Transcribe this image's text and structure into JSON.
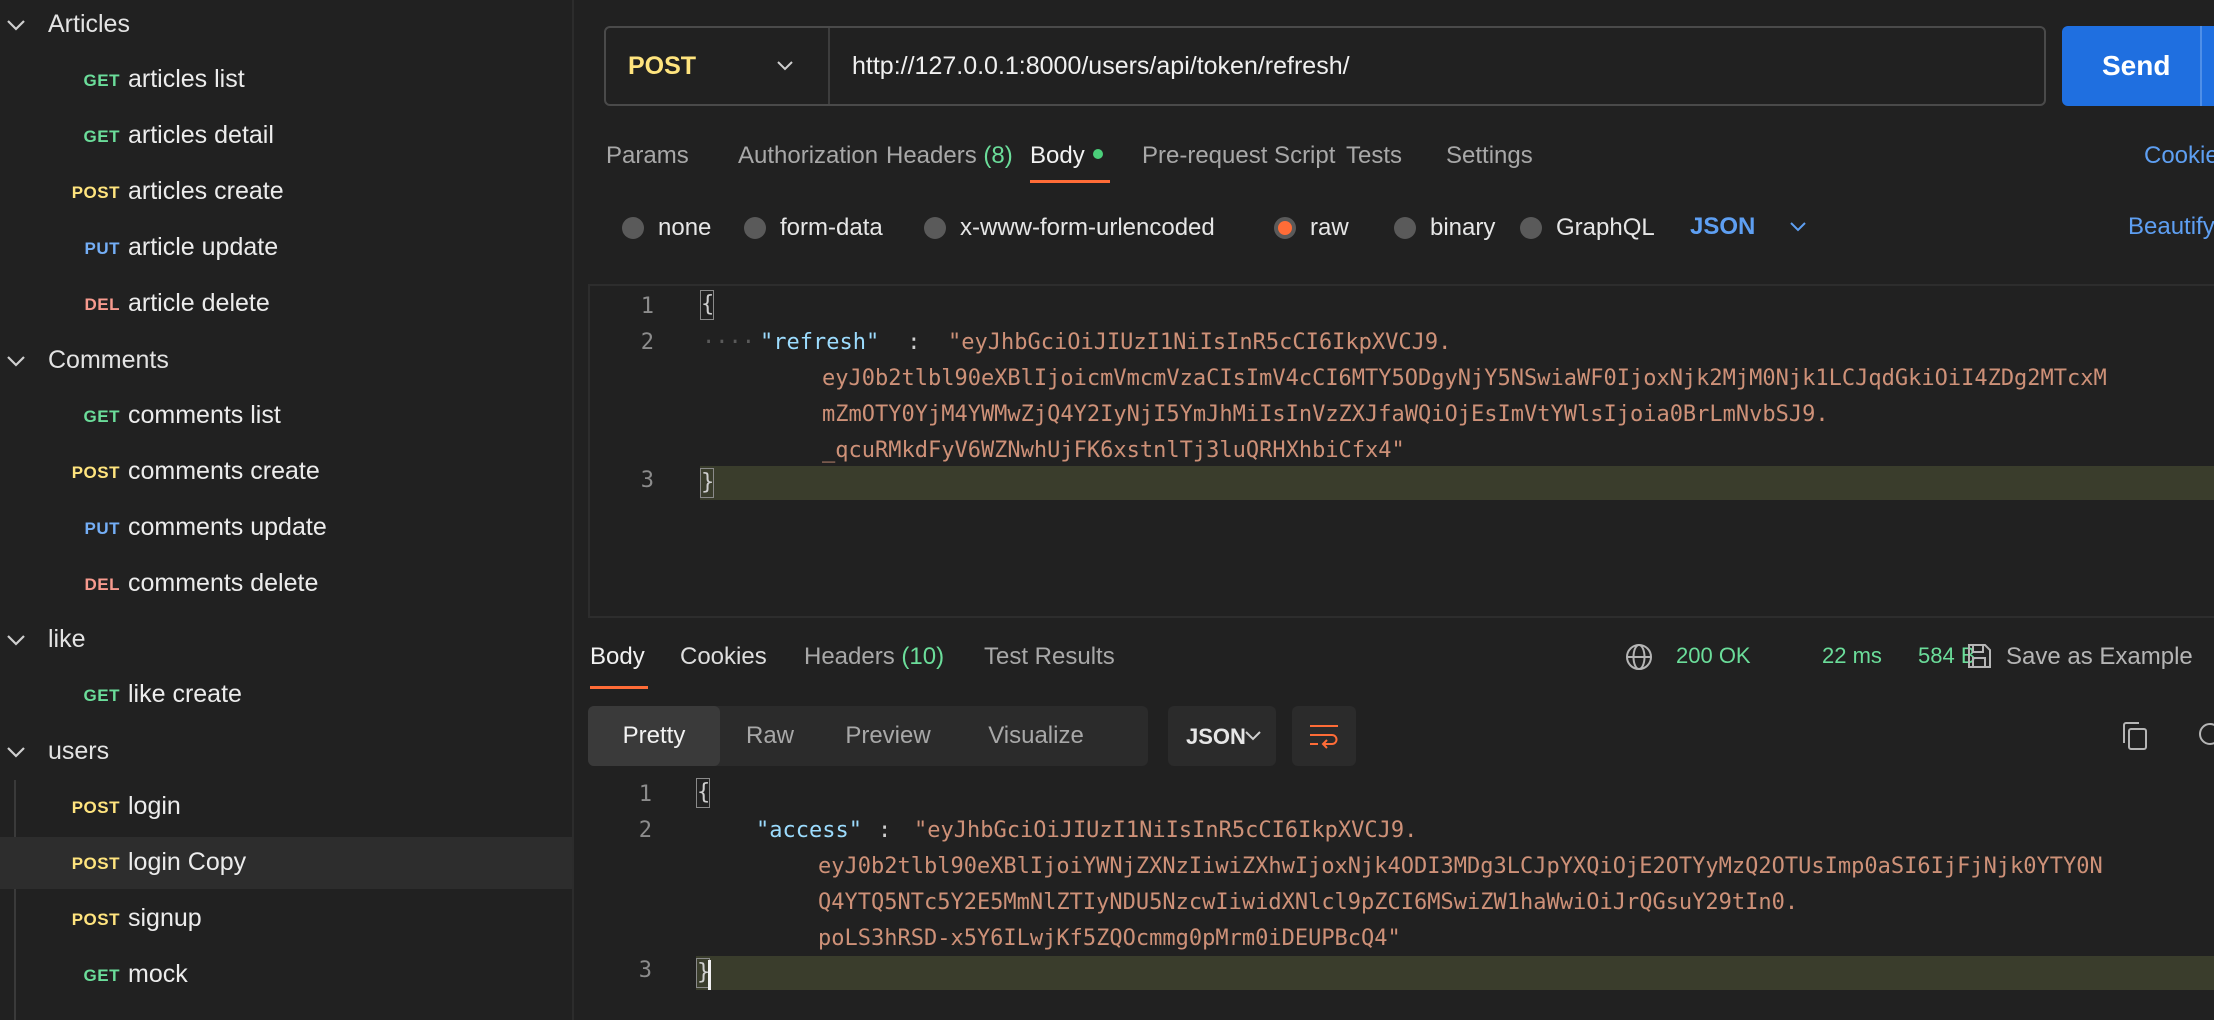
{
  "sidebar": {
    "folders": {
      "articles": "Articles",
      "comments": "Comments",
      "like": "like",
      "users": "users"
    },
    "requests": {
      "articles_list": {
        "method": "GET",
        "name": "articles list"
      },
      "articles_detail": {
        "method": "GET",
        "name": "articles detail"
      },
      "articles_create": {
        "method": "POST",
        "name": "articles create"
      },
      "article_update": {
        "method": "PUT",
        "name": "article update"
      },
      "article_delete": {
        "method": "DEL",
        "name": "article delete"
      },
      "comments_list": {
        "method": "GET",
        "name": "comments list"
      },
      "comments_create": {
        "method": "POST",
        "name": "comments create"
      },
      "comments_update": {
        "method": "PUT",
        "name": "comments update"
      },
      "comments_delete": {
        "method": "DEL",
        "name": "comments delete"
      },
      "like_create": {
        "method": "GET",
        "name": "like create"
      },
      "login": {
        "method": "POST",
        "name": "login"
      },
      "login_copy": {
        "method": "POST",
        "name": "login Copy"
      },
      "signup": {
        "method": "POST",
        "name": "signup"
      },
      "mock": {
        "method": "GET",
        "name": "mock"
      }
    }
  },
  "request": {
    "method": "POST",
    "url": "http://127.0.0.1:8000/users/api/token/refresh/",
    "send_label": "Send",
    "tabs": {
      "params": "Params",
      "authorization": "Authorization",
      "headers": "Headers",
      "headers_count": "(8)",
      "body": "Body",
      "pre_request": "Pre-request Script",
      "tests": "Tests",
      "settings": "Settings",
      "cookies": "Cookies"
    },
    "body_types": {
      "none": "none",
      "form_data": "form-data",
      "urlencoded": "x-www-form-urlencoded",
      "raw": "raw",
      "binary": "binary",
      "graphql": "GraphQL",
      "selected": "raw"
    },
    "format": "JSON",
    "beautify": "Beautify",
    "body_lines": {
      "n1": "1",
      "n2": "2",
      "n3": "3",
      "open_brace": "{",
      "close_brace": "}",
      "indent": "····",
      "key": "\"refresh\"",
      "colon": " : ",
      "v1": "\"eyJhbGciOiJIUzI1NiIsInR5cCI6IkpXVCJ9.",
      "v2": "eyJ0b2tlbl90eXBlIjoicmVmcmVzaCIsImV4cCI6MTY5ODgyNjY5NSwiaWF0IjoxNjk2MjM0Njk1LCJqdGkiOiI4ZDg2MTcxM",
      "v3": "mZmOTY0YjM4YWMwZjQ4Y2IyNjI5YmJhMiIsInVzZXJfaWQiOjEsImVtYWlsIjoia0BrLmNvbSJ9.",
      "v4": "_qcuRMkdFyV6WZNwhUjFK6xstnlTj3luQRHXhbiCfx4\""
    }
  },
  "response": {
    "tabs": {
      "body": "Body",
      "cookies": "Cookies",
      "headers": "Headers",
      "headers_count": "(10)",
      "test_results": "Test Results"
    },
    "status": "200 OK",
    "time": "22 ms",
    "size": "584 B",
    "save_example": "Save as Example",
    "views": {
      "pretty": "Pretty",
      "raw": "Raw",
      "preview": "Preview",
      "visualize": "Visualize"
    },
    "format": "JSON",
    "body_lines": {
      "n1": "1",
      "n2": "2",
      "n3": "3",
      "open_brace": "{",
      "close_brace": "}",
      "key": "\"access\"",
      "colon": ": ",
      "v1": "\"eyJhbGciOiJIUzI1NiIsInR5cCI6IkpXVCJ9.",
      "v2": "eyJ0b2tlbl90eXBlIjoiYWNjZXNzIiwiZXhwIjoxNjk4ODI3MDg3LCJpYXQiOjE2OTYyMzQ2OTUsImp0aSI6IjFjNjk0YTY0N",
      "v3": "Q4YTQ5NTc5Y2E5MmNlZTIyNDU5NzcwIiwidXNlcl9pZCI6MSwiZW1haWwiOiJrQGsuY29tIn0.",
      "v4": "poLS3hRSD-x5Y6ILwjKf5ZQOcmmg0pMrm0iDEUPBcQ4\""
    }
  },
  "colors": {
    "accent": "#ff6c37",
    "send": "#1f6fe0",
    "get": "#6bdd9a",
    "post": "#ffe47e",
    "put": "#74aef6",
    "del": "#f79a8e"
  }
}
